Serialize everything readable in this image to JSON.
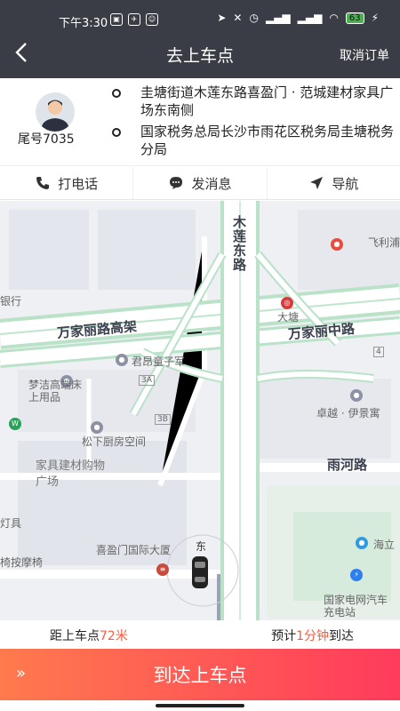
{
  "status": {
    "time": "下午3:30",
    "battery": "63"
  },
  "header": {
    "title": "去上车点",
    "cancel": "取消订单"
  },
  "passenger": {
    "tail": "尾号7035",
    "pickup": "圭塘街道木莲东路喜盈门 · 范城建材家具广场东南侧",
    "dropoff": "国家税务总局长沙市雨花区税务局圭塘税务分局"
  },
  "actions": {
    "call": "打电话",
    "message": "发消息",
    "navigate": "导航"
  },
  "map": {
    "road_wanjia": "万家丽路高架",
    "road_wanjia_mid": "万家丽中路",
    "road_mulian": "木莲东路",
    "road_yuhe": "雨河路",
    "poi_jiunzi": "君昂童子军",
    "poi_mengjie": "梦洁高端床上用品",
    "poi_songxia": "松下厨房空间",
    "poi_jiaju": "家具建材购物广场",
    "poi_xiyingmen": "喜盈门国际大厦",
    "poi_zhuoyue": "卓越 · 伊景寓",
    "poi_dianwang": "国家电网汽车充电站",
    "poi_dapu": "大塘",
    "poi_feili": "飞利浦",
    "poi_haili": "海立",
    "poi_anmo": "椅按摩椅",
    "poi_bank": "银行",
    "poi_deng": "灯具",
    "exit_3a": "3A",
    "exit_3b": "3B",
    "exit_4": "4",
    "car_label": "东"
  },
  "eta": {
    "distance_prefix": "距上车点",
    "distance": "72米",
    "time_prefix": "预计",
    "time": "1分钟",
    "time_suffix": "到达"
  },
  "arrive": {
    "label": "到达上车点",
    "chevron": "»"
  }
}
